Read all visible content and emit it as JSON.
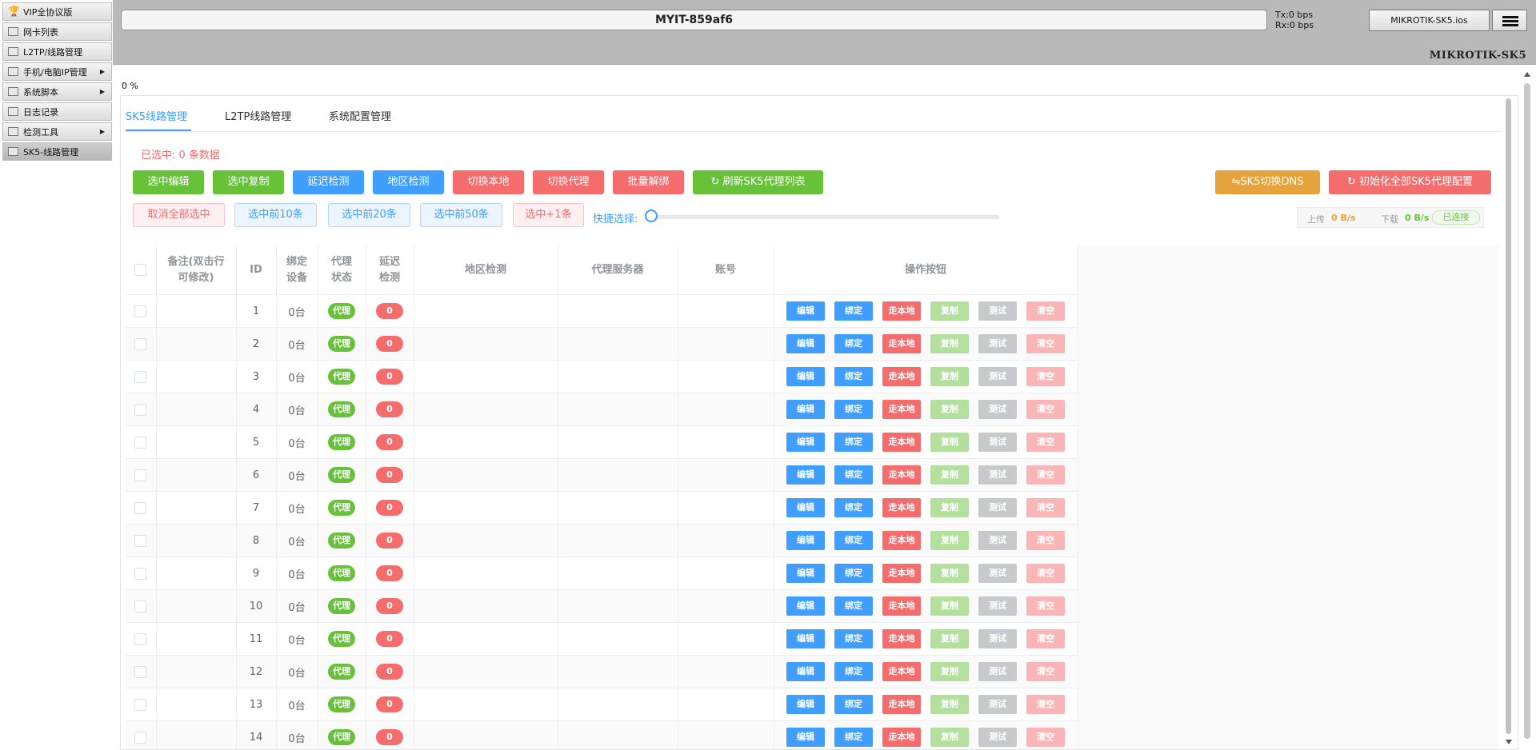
{
  "sidebar": {
    "items": [
      {
        "label": "VIP全协议版",
        "icon": "trophy-icon",
        "has_submenu": false,
        "active": false
      },
      {
        "label": "网卡列表",
        "icon": "nic-icon",
        "has_submenu": false,
        "active": false
      },
      {
        "label": "L2TP/线路管理",
        "icon": "network-icon",
        "has_submenu": false,
        "active": false
      },
      {
        "label": "手机/电脑IP管理",
        "icon": "devices-icon",
        "has_submenu": true,
        "active": false
      },
      {
        "label": "系统脚本",
        "icon": "script-icon",
        "has_submenu": true,
        "active": false
      },
      {
        "label": "日志记录",
        "icon": "log-icon",
        "has_submenu": false,
        "active": false
      },
      {
        "label": "检测工具",
        "icon": "tools-icon",
        "has_submenu": true,
        "active": false
      },
      {
        "label": "SK5-线路管理",
        "icon": "sk5-icon",
        "has_submenu": false,
        "active": true
      }
    ]
  },
  "header": {
    "router_name": "MYIT-859af6",
    "tx": "Tx:0 bps",
    "rx": "Rx:0 bps",
    "identity_button": "MIKROTIK-SK5.ios",
    "brand": "MIKROTIK-SK5",
    "progress": "0 %"
  },
  "tabs": [
    {
      "label": "SK5线路管理",
      "active": true
    },
    {
      "label": "L2TP线路管理",
      "active": false
    },
    {
      "label": "系统配置管理",
      "active": false
    }
  ],
  "selection": {
    "label": "已选中:",
    "count_text": "0 条数据"
  },
  "toolbar": {
    "select_edit": "选中编辑",
    "select_copy": "选中复制",
    "latency_test": "延迟检测",
    "region_test": "地区检测",
    "switch_local": "切换本地",
    "switch_proxy": "切换代理",
    "batch_unbind": "批量解绑",
    "refresh_list": "刷新SK5代理列表",
    "switch_dns": "⇋SK5切换DNS",
    "init_all": "初始化全部SK5代理配置"
  },
  "select_bar": {
    "deselect_all": "取消全部选中",
    "first10": "选中前10条",
    "first20": "选中前20条",
    "first50": "选中前50条",
    "plus1": "选中+1条",
    "quick_select": "快捷选择:",
    "quick_select_value": 0
  },
  "stats": {
    "upload_label": "上传",
    "upload_value": "0 B/s",
    "download_label": "下载",
    "download_value": "0 B/s",
    "connection_status": "已连接"
  },
  "table": {
    "columns": [
      "备注(双击行可修改)",
      "ID",
      "绑定设备",
      "代理状态",
      "延迟检测",
      "地区检测",
      "代理服务器",
      "账号",
      "操作按钮"
    ],
    "ops": {
      "edit": "编辑",
      "bind": "绑定",
      "local": "走本地",
      "copy": "复制",
      "test": "测试",
      "clear": "清空"
    },
    "rows": [
      {
        "id": "1",
        "device": "0台",
        "status": "代理",
        "latency": "0"
      },
      {
        "id": "2",
        "device": "0台",
        "status": "代理",
        "latency": "0"
      },
      {
        "id": "3",
        "device": "0台",
        "status": "代理",
        "latency": "0"
      },
      {
        "id": "4",
        "device": "0台",
        "status": "代理",
        "latency": "0"
      },
      {
        "id": "5",
        "device": "0台",
        "status": "代理",
        "latency": "0"
      },
      {
        "id": "6",
        "device": "0台",
        "status": "代理",
        "latency": "0"
      },
      {
        "id": "7",
        "device": "0台",
        "status": "代理",
        "latency": "0"
      },
      {
        "id": "8",
        "device": "0台",
        "status": "代理",
        "latency": "0"
      },
      {
        "id": "9",
        "device": "0台",
        "status": "代理",
        "latency": "0"
      },
      {
        "id": "10",
        "device": "0台",
        "status": "代理",
        "latency": "0"
      },
      {
        "id": "11",
        "device": "0台",
        "status": "代理",
        "latency": "0"
      },
      {
        "id": "12",
        "device": "0台",
        "status": "代理",
        "latency": "0"
      },
      {
        "id": "13",
        "device": "0台",
        "status": "代理",
        "latency": "0"
      },
      {
        "id": "14",
        "device": "0台",
        "status": "代理",
        "latency": "0"
      }
    ]
  }
}
